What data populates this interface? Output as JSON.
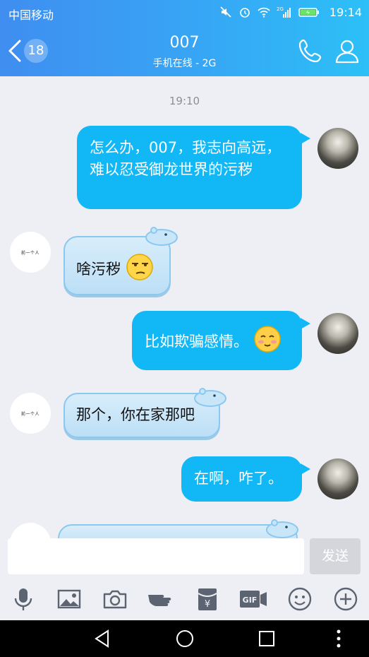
{
  "status_bar": {
    "carrier": "中国移动",
    "time": "19:14",
    "icons": [
      "mute-icon",
      "alarm-icon",
      "wifi-icon",
      "signal-2g-icon",
      "battery-charging-icon"
    ],
    "network_badge": "2G"
  },
  "header": {
    "unread_count": "18",
    "title": "007",
    "subtitle": "手机在线 - 2G",
    "actions": [
      "phone-icon",
      "profile-icon"
    ]
  },
  "chat": {
    "timestamp": "19:10",
    "messages": [
      {
        "side": "out",
        "text": "怎么办，007，我志向高远，难以忍受御龙世界的污秽"
      },
      {
        "side": "in",
        "text": "啥污秽",
        "emoji": "smirk-face-icon"
      },
      {
        "side": "out",
        "text": "比如欺骗感情。",
        "emoji": "blushing-face-icon"
      },
      {
        "side": "in",
        "text": "那个，你在家那吧"
      },
      {
        "side": "out",
        "text": "在啊，咋了。"
      }
    ],
    "other_avatar_text": "前一个人"
  },
  "input": {
    "placeholder": "",
    "send_label": "发送"
  },
  "toolbar": {
    "items": [
      "microphone-icon",
      "image-icon",
      "camera-icon",
      "hand-poke-icon",
      "red-packet-icon",
      "gif-icon",
      "emoji-icon",
      "plus-icon"
    ]
  },
  "colors": {
    "header_start": "#3f8ef0",
    "header_end": "#2cc0f7",
    "bubble_out": "#12b7f5",
    "bubble_in": "#c9e6f9",
    "background": "#eeeff4"
  }
}
